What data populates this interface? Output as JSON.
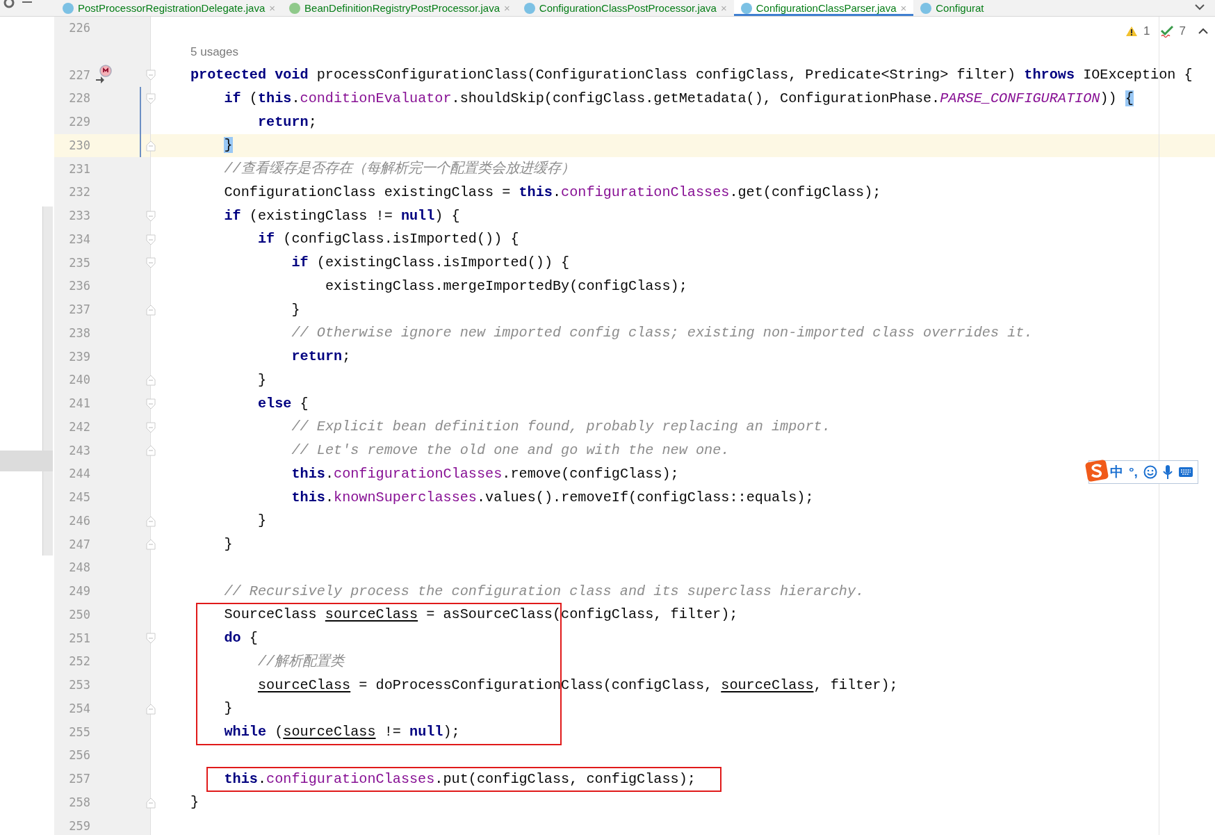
{
  "tabs": [
    {
      "label": "PostProcessorRegistrationDelegate.java",
      "kind": "class",
      "selected": false,
      "close": "×"
    },
    {
      "label": "BeanDefinitionRegistryPostProcessor.java",
      "kind": "interface",
      "selected": false,
      "close": "×"
    },
    {
      "label": "ConfigurationClassPostProcessor.java",
      "kind": "class",
      "selected": false,
      "close": "×"
    },
    {
      "label": "ConfigurationClassParser.java",
      "kind": "class",
      "selected": true,
      "close": "×"
    },
    {
      "label": "Configurat",
      "kind": "class",
      "selected": false
    }
  ],
  "inspections": {
    "warnings": "1",
    "checks": "7"
  },
  "lines": [
    {
      "kind": "code",
      "number": "226",
      "current": false,
      "changed": false
    },
    {
      "kind": "inlay",
      "text": "5 usages"
    },
    {
      "kind": "code",
      "number": "227",
      "current": false,
      "changed": false,
      "overrides": true,
      "fold_start": true,
      "segments": [
        {
          "kind": "kw",
          "text": "protected void"
        },
        {
          "kind": "plain",
          "text": " processConfigurationClass(ConfigurationClass configClass, Predicate<String> filter) "
        },
        {
          "kind": "kw",
          "text": "throws"
        },
        {
          "kind": "plain",
          "text": " IOException {"
        }
      ],
      "children": [
        {
          "kind": "code",
          "number": "228",
          "current": false,
          "changed": true,
          "fold_start": true,
          "segments": [
            {
              "kind": "kw",
              "text": "if"
            },
            {
              "kind": "plain",
              "text": " ("
            },
            {
              "kind": "kw",
              "text": "this"
            },
            {
              "kind": "plain",
              "text": "."
            },
            {
              "kind": "field",
              "text": "conditionEvaluator"
            },
            {
              "kind": "plain",
              "text": ".shouldSkip(configClass.getMetadata(), ConfigurationPhase."
            },
            {
              "kind": "const",
              "text": "PARSE_CONFIGURATION"
            },
            {
              "kind": "plain",
              "text": ")) "
            },
            {
              "kind": "match",
              "text": "{"
            }
          ],
          "children": [
            {
              "kind": "code",
              "number": "229",
              "current": false,
              "changed": true,
              "segments": [
                {
                  "kind": "kw",
                  "text": "return"
                },
                {
                  "kind": "plain",
                  "text": ";"
                }
              ]
            }
          ]
        },
        {
          "kind": "code",
          "number": "230",
          "current": true,
          "changed": true,
          "fold_end": true,
          "segments": [
            {
              "kind": "match",
              "text": "}"
            }
          ]
        },
        {
          "kind": "code",
          "number": "231",
          "current": false,
          "changed": false,
          "segments": [
            {
              "kind": "comment",
              "text": "//查看缓存是否存在（每解析完一个配置类会放进缓存）"
            }
          ]
        },
        {
          "kind": "code",
          "number": "232",
          "current": false,
          "changed": false,
          "segments": [
            {
              "kind": "plain",
              "text": "ConfigurationClass existingClass = "
            },
            {
              "kind": "kw",
              "text": "this"
            },
            {
              "kind": "plain",
              "text": "."
            },
            {
              "kind": "field",
              "text": "configurationClasses"
            },
            {
              "kind": "plain",
              "text": ".get(configClass);"
            }
          ]
        },
        {
          "kind": "code",
          "number": "233",
          "current": false,
          "changed": false,
          "fold_start": true,
          "segments": [
            {
              "kind": "kw",
              "text": "if"
            },
            {
              "kind": "plain",
              "text": " (existingClass != "
            },
            {
              "kind": "kw",
              "text": "null"
            },
            {
              "kind": "plain",
              "text": ") {"
            }
          ],
          "children": [
            {
              "kind": "code",
              "number": "234",
              "current": false,
              "changed": false,
              "fold_start": true,
              "segments": [
                {
                  "kind": "kw",
                  "text": "if"
                },
                {
                  "kind": "plain",
                  "text": " (configClass.isImported()) {"
                }
              ],
              "children": [
                {
                  "kind": "code",
                  "number": "235",
                  "current": false,
                  "changed": false,
                  "fold_start": true,
                  "segments": [
                    {
                      "kind": "kw",
                      "text": "if"
                    },
                    {
                      "kind": "plain",
                      "text": " (existingClass.isImported()) {"
                    }
                  ],
                  "children": [
                    {
                      "kind": "code",
                      "number": "236",
                      "current": false,
                      "changed": false,
                      "segments": [
                        {
                          "kind": "plain",
                          "text": "existingClass.mergeImportedBy(configClass);"
                        }
                      ]
                    }
                  ]
                },
                {
                  "kind": "code",
                  "number": "237",
                  "current": false,
                  "changed": false,
                  "fold_end": true,
                  "segments": [
                    {
                      "kind": "plain",
                      "text": "}"
                    }
                  ]
                },
                {
                  "kind": "code",
                  "number": "238",
                  "current": false,
                  "changed": false,
                  "segments": [
                    {
                      "kind": "comment",
                      "text": "// Otherwise ignore new imported config class; existing non-imported class overrides it."
                    }
                  ]
                },
                {
                  "kind": "code",
                  "number": "239",
                  "current": false,
                  "changed": false,
                  "segments": [
                    {
                      "kind": "kw",
                      "text": "return"
                    },
                    {
                      "kind": "plain",
                      "text": ";"
                    }
                  ]
                }
              ]
            },
            {
              "kind": "code",
              "number": "240",
              "current": false,
              "changed": false,
              "fold_end": true,
              "segments": [
                {
                  "kind": "plain",
                  "text": "}"
                }
              ]
            },
            {
              "kind": "code",
              "number": "241",
              "current": false,
              "changed": false,
              "fold_start": true,
              "segments": [
                {
                  "kind": "kw",
                  "text": "else"
                },
                {
                  "kind": "plain",
                  "text": " {"
                }
              ],
              "children": [
                {
                  "kind": "code",
                  "number": "242",
                  "current": false,
                  "changed": false,
                  "fold_start": true,
                  "segments": [
                    {
                      "kind": "comment",
                      "text": "// Explicit bean definition found, probably replacing an import."
                    }
                  ]
                },
                {
                  "kind": "code",
                  "number": "243",
                  "current": false,
                  "changed": false,
                  "fold_end": true,
                  "segments": [
                    {
                      "kind": "comment",
                      "text": "// Let's remove the old one and go with the new one."
                    }
                  ]
                },
                {
                  "kind": "code",
                  "number": "244",
                  "current": false,
                  "changed": false,
                  "segments": [
                    {
                      "kind": "kw",
                      "text": "this"
                    },
                    {
                      "kind": "plain",
                      "text": "."
                    },
                    {
                      "kind": "field",
                      "text": "configurationClasses"
                    },
                    {
                      "kind": "plain",
                      "text": ".remove(configClass);"
                    }
                  ]
                },
                {
                  "kind": "code",
                  "number": "245",
                  "current": false,
                  "changed": false,
                  "segments": [
                    {
                      "kind": "kw",
                      "text": "this"
                    },
                    {
                      "kind": "plain",
                      "text": "."
                    },
                    {
                      "kind": "field",
                      "text": "knownSuperclasses"
                    },
                    {
                      "kind": "plain",
                      "text": ".values().removeIf(configClass::equals);"
                    }
                  ]
                }
              ]
            },
            {
              "kind": "code",
              "number": "246",
              "current": false,
              "changed": false,
              "fold_end": true,
              "segments": [
                {
                  "kind": "plain",
                  "text": "}"
                }
              ]
            }
          ]
        },
        {
          "kind": "code",
          "number": "247",
          "current": false,
          "changed": false,
          "fold_end": true,
          "segments": [
            {
              "kind": "plain",
              "text": "}"
            }
          ]
        },
        {
          "kind": "code",
          "number": "248",
          "current": false,
          "changed": false
        },
        {
          "kind": "code",
          "number": "249",
          "current": false,
          "changed": false,
          "segments": [
            {
              "kind": "comment",
              "text": "// Recursively process the configuration class and its superclass hierarchy."
            }
          ]
        },
        {
          "kind": "code",
          "number": "250",
          "current": false,
          "changed": false,
          "frame_start": true,
          "segments": [
            {
              "kind": "plain",
              "text": "SourceClass "
            },
            {
              "kind": "var",
              "text": "sourceClass"
            },
            {
              "kind": "plain",
              "text": " = asSourceClass(configClass, filter);"
            }
          ]
        },
        {
          "kind": "code",
          "number": "251",
          "current": false,
          "changed": false,
          "fold_start": true,
          "segments": [
            {
              "kind": "kw",
              "text": "do"
            },
            {
              "kind": "plain",
              "text": " {"
            }
          ],
          "children": [
            {
              "kind": "code",
              "number": "252",
              "current": false,
              "changed": false,
              "segments": [
                {
                  "kind": "comment",
                  "text": "//解析配置类"
                }
              ]
            },
            {
              "kind": "code",
              "number": "253",
              "current": false,
              "changed": false,
              "segments": [
                {
                  "kind": "var",
                  "text": "sourceClass"
                },
                {
                  "kind": "plain",
                  "text": " = doProcessConfigurationClass(configClass, "
                },
                {
                  "kind": "var",
                  "text": "sourceClass"
                },
                {
                  "kind": "plain",
                  "text": ", filter);"
                }
              ]
            }
          ]
        },
        {
          "kind": "code",
          "number": "254",
          "current": false,
          "changed": false,
          "fold_end": true,
          "segments": [
            {
              "kind": "plain",
              "text": "}"
            }
          ]
        },
        {
          "kind": "code",
          "number": "255",
          "current": false,
          "changed": false,
          "frame_end": true,
          "segments": [
            {
              "kind": "kw",
              "text": "while"
            },
            {
              "kind": "plain",
              "text": " ("
            },
            {
              "kind": "var",
              "text": "sourceClass"
            },
            {
              "kind": "plain",
              "text": " != "
            },
            {
              "kind": "kw",
              "text": "null"
            },
            {
              "kind": "plain",
              "text": ");"
            }
          ]
        },
        {
          "kind": "code",
          "number": "256",
          "current": false,
          "changed": false
        },
        {
          "kind": "code",
          "number": "257",
          "current": false,
          "changed": false,
          "frame_start": true,
          "frame_end": true,
          "segments": [
            {
              "kind": "kw",
              "text": "this"
            },
            {
              "kind": "plain",
              "text": "."
            },
            {
              "kind": "field",
              "text": "configurationClasses"
            },
            {
              "kind": "plain",
              "text": ".put(configClass, configClass);"
            }
          ]
        }
      ]
    },
    {
      "kind": "code",
      "number": "258",
      "current": false,
      "changed": false,
      "fold_end": true,
      "segments": [
        {
          "kind": "plain",
          "text": "}"
        }
      ]
    },
    {
      "kind": "code",
      "number": "259",
      "current": false,
      "changed": false
    }
  ],
  "ime_toolbar": {
    "mode": "中",
    "punctuation": "°,"
  }
}
